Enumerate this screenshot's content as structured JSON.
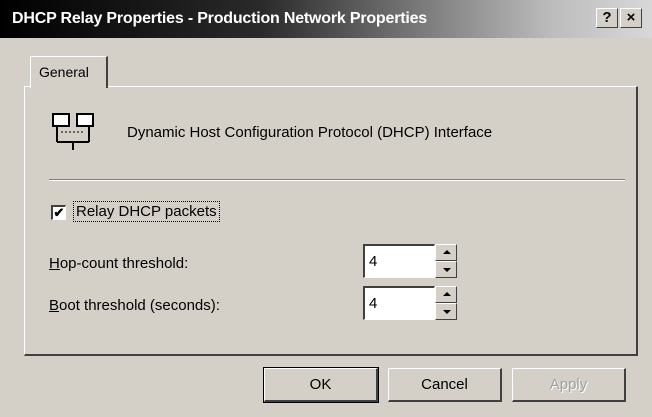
{
  "window": {
    "title": "DHCP Relay Properties - Production Network Properties",
    "help_button": "?",
    "close_button": "×"
  },
  "tabs": [
    {
      "label": "General",
      "selected": true
    }
  ],
  "general": {
    "interface_icon": "network-interface-icon",
    "interface_text": "Dynamic Host Configuration Protocol (DHCP) Interface",
    "relay_checkbox": {
      "label": "Relay DHCP packets",
      "checked": true,
      "mark": "✔"
    },
    "hop_count": {
      "label_ul": "H",
      "label_rest": "op-count threshold:",
      "value": "4"
    },
    "boot_threshold": {
      "label_ul": "B",
      "label_rest": "oot threshold (seconds):",
      "value": "4"
    }
  },
  "buttons": {
    "ok": "OK",
    "cancel": "Cancel",
    "apply": "Apply"
  }
}
